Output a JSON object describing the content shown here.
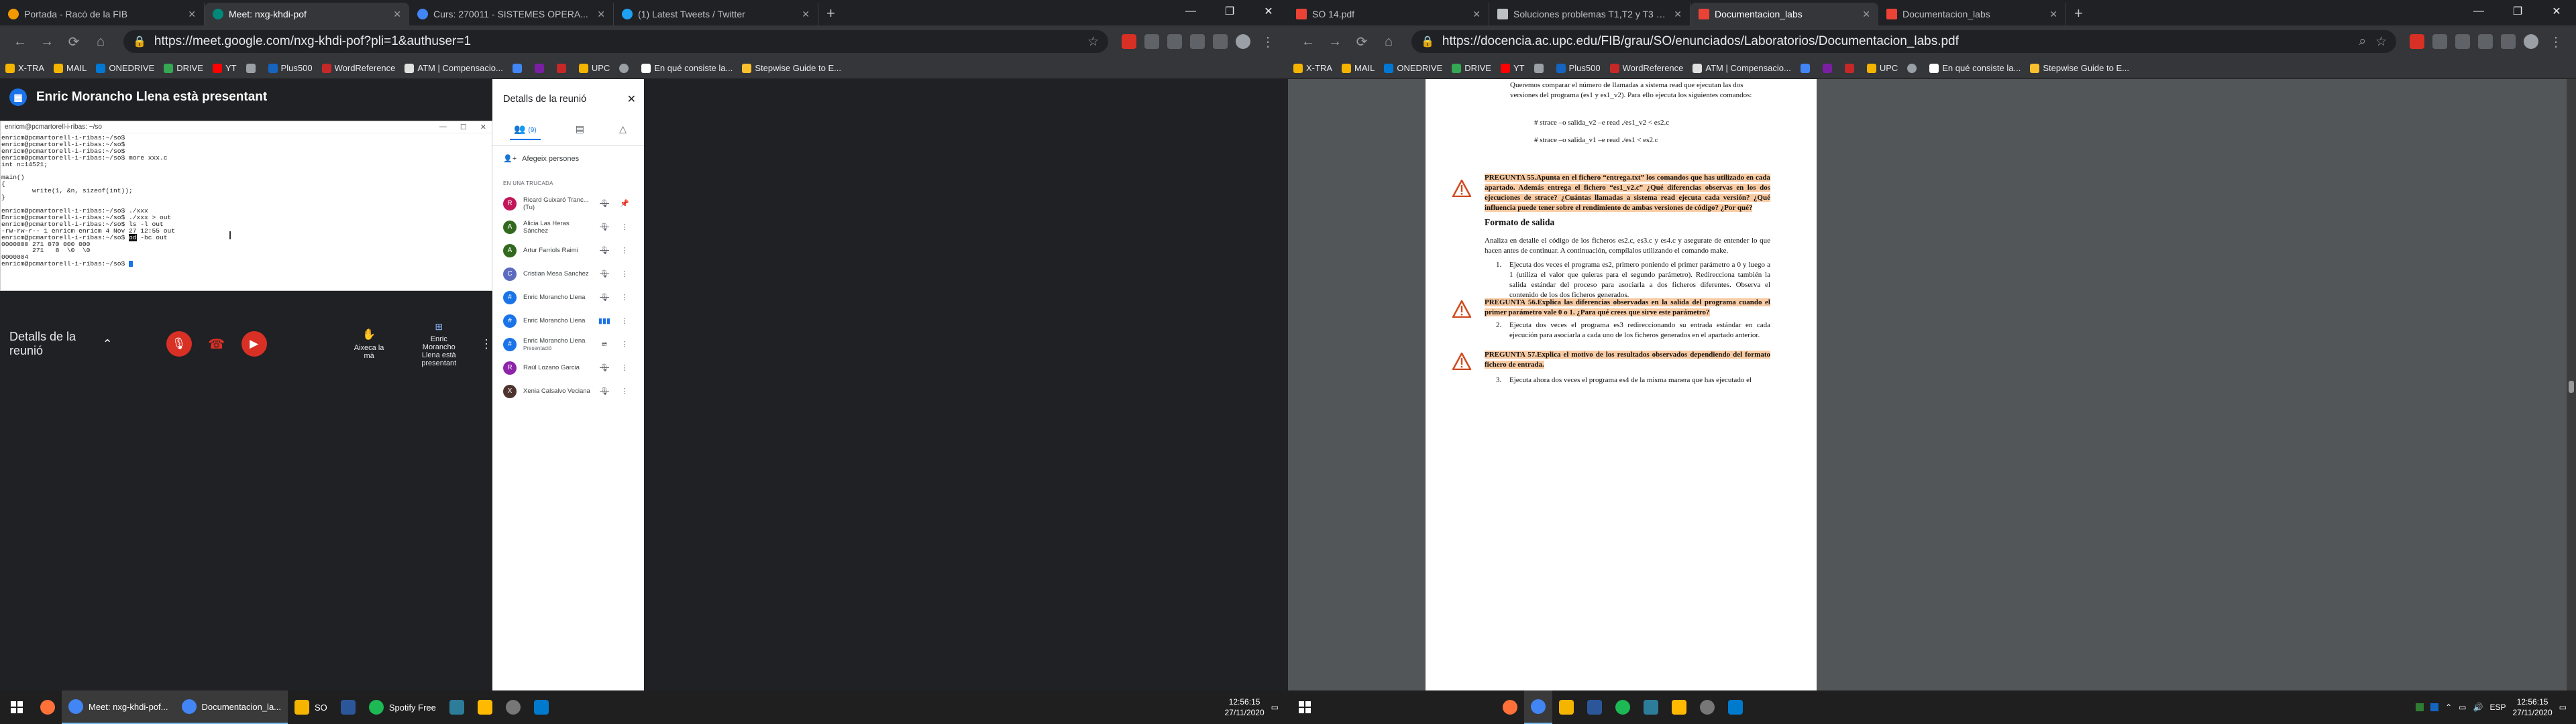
{
  "left": {
    "tabs": [
      {
        "title": "Portada - Racó de la FIB",
        "color": "#f29900",
        "active": false
      },
      {
        "title": "Meet: nxg-khdi-pof",
        "color": "#00897b",
        "active": true
      },
      {
        "title": "Curs: 270011 - SISTEMES OPERA...",
        "color": "#4285f4",
        "active": false
      },
      {
        "title": "(1) Latest Tweets / Twitter",
        "color": "#1da1f2",
        "active": false
      }
    ],
    "url": "https://meet.google.com/nxg-khdi-pof?pli=1&authuser=1",
    "bookmarks": [
      "X-TRA",
      "MAIL",
      "ONEDRIVE",
      "DRIVE",
      "YT",
      "",
      "Plus500",
      "WordReference",
      "ATM | Compensacio...",
      "",
      "",
      "",
      "UPC",
      "",
      "En qué consiste la...",
      "Stepwise Guide to E..."
    ],
    "presenter_banner": "Enric Morancho Llena està presentant",
    "terminal": {
      "title": "enricm@pcmartorell-i-ribas: ~/so",
      "lines": [
        "enricm@pcmartorell-i-ribas:~/so$",
        "enricm@pcmartorell-i-ribas:~/so$",
        "enricm@pcmartorell-i-ribas:~/so$",
        "enricm@pcmartorell-i-ribas:~/so$ more xxx.c",
        "int n=14521;",
        "",
        "main()",
        "{",
        "        write(1, &n, sizeof(int));",
        "}",
        "",
        "enricm@pcmartorell-i-ribas:~/so$ ./xxx",
        "Enricm@pcmartorell-i-ribas:~/so$ ./xxx > out",
        "enricm@pcmartorell-i-ribas:~/so$ ls -l out",
        "-rw-rw-r-- 1 enricm enricm 4 Nov 27 12:55 out",
        "enricm@pcmartorell-i-ribas:~/so$ od -bc out",
        "0000000 271 070 000 000",
        "        271   8  \\0  \\0",
        "0000004",
        "enricm@pcmartorell-i-ribas:~/so$ "
      ]
    },
    "controls": {
      "details_label": "Detalls de la reunió",
      "raise_hand": "Aixeca la mà",
      "present_label": "Enric Morancho Llena està presentant"
    },
    "panel": {
      "title": "Detalls de la reunió",
      "people_count": "(9)",
      "add_people": "Afegeix persones",
      "section": "EN UNA TRUCADA",
      "participants": [
        {
          "initial": "R",
          "name": "Ricard Guixaró Tranc... (Tu)",
          "sub": "",
          "color": "#c2185b",
          "icon": "mic-off"
        },
        {
          "initial": "A",
          "name": "Alicia Las Heras Sánchez",
          "sub": "",
          "color": "#33691e",
          "icon": "mic-off"
        },
        {
          "initial": "A",
          "name": "Artur Farriols Raimi",
          "sub": "",
          "color": "#33691e",
          "icon": "mic-off"
        },
        {
          "initial": "C",
          "name": "Cristian Mesa Sanchez",
          "sub": "",
          "color": "#5c6bc0",
          "icon": "mic-off"
        },
        {
          "initial": "#",
          "name": "Enric Morancho Llena",
          "sub": "",
          "color": "#1a73e8",
          "icon": "mic-off"
        },
        {
          "initial": "#",
          "name": "Enric Morancho Llena",
          "sub": "",
          "color": "#1a73e8",
          "icon": "speaking"
        },
        {
          "initial": "#",
          "name": "Enric Morancho Llena",
          "sub": "Presentació",
          "color": "#1a73e8",
          "icon": "present-off"
        },
        {
          "initial": "R",
          "name": "Raúl Lozano Garcia",
          "sub": "",
          "color": "#8e24aa",
          "icon": "mic-off"
        },
        {
          "initial": "X",
          "name": "Xenia Calsalvo Veciana",
          "sub": "",
          "color": "#4e342e",
          "icon": "mic-off"
        }
      ]
    },
    "taskbar": {
      "apps": [
        "Meet: nxg-khdi-pof...",
        "Documentacion_la...",
        "SO",
        "",
        "Spotify Free"
      ],
      "time": "12:56:15",
      "date": "27/11/2020"
    }
  },
  "right": {
    "tabs": [
      {
        "title": "SO 14.pdf",
        "color": "#ea4335",
        "active": false
      },
      {
        "title": "Soluciones problemas T1,T2 y T3 - ...",
        "color": "#bdc1c6",
        "active": false
      },
      {
        "title": "Documentacion_labs",
        "color": "#ea4335",
        "active": true
      },
      {
        "title": "Documentacion_labs",
        "color": "#ea4335",
        "active": false
      }
    ],
    "url": "https://docencia.ac.upc.edu/FIB/grau/SO/enunciados/Laboratorios/Documentacion_labs.pdf",
    "pdf": {
      "intro1": "Queremos comparar el número de llamadas a sistema read que ejecutan las dos",
      "intro2": "versiones del programa (es1 y es1_v2). Para ello ejecuta los siguientes comandos:",
      "cmd1": "# strace –o salida_v2 –e read ./es1_v2 < es2.c",
      "cmd2": "# strace  –o salida_v1 –e read ./es1 < es2.c",
      "q55": "PREGUNTA 55.Apunta en el fichero “entrega.txt” los comandos que has utilizado en cada apartado. Además entrega el fichero “es1_v2.c” ¿Qué diferencias observas en los dos ejecuciones de strace? ¿Cuántas llamadas a sistema read ejecuta cada versión? ¿Qué influencia puede tener sobre el rendimiento de ambas versiones de código? ¿Por qué?",
      "heading": "Formato de salida",
      "p1": "Analiza en detalle el código de los ficheros es2.c, es3.c y es4.c y asegurate de entender lo que hacen antes de continuar. A continuación, compílalos utilizando el comando make.",
      "item1": "Ejecuta dos veces el programa es2, primero poniendo el primer parámetro a 0 y luego a 1 (utiliza el valor que quieras para el segundo parámetro). Redirecciona también la salida estándar del proceso para asociarla a dos ficheros diferentes. Observa el contenido de los dos ficheros generados.",
      "q56": "PREGUNTA 56.Explica las diferencias observadas en la salida del programa cuando el primer parámetro vale 0 o 1. ¿Para qué crees que sirve este parámetro?",
      "item2": "Ejecuta dos veces el programa es3 redireccionando su entrada estándar en cada ejecución para asociarla a cada uno de los ficheros generados en el apartado anterior.",
      "q57": "PREGUNTA 57.Explica el motivo de los resultados observados dependiendo del formato fichero de entrada.",
      "item3": "Ejecuta ahora dos veces el programa es4 de la misma manera que has ejecutado el"
    },
    "taskbar": {
      "time": "12:56:15",
      "date": "27/11/2020",
      "lang": "ESP"
    }
  }
}
